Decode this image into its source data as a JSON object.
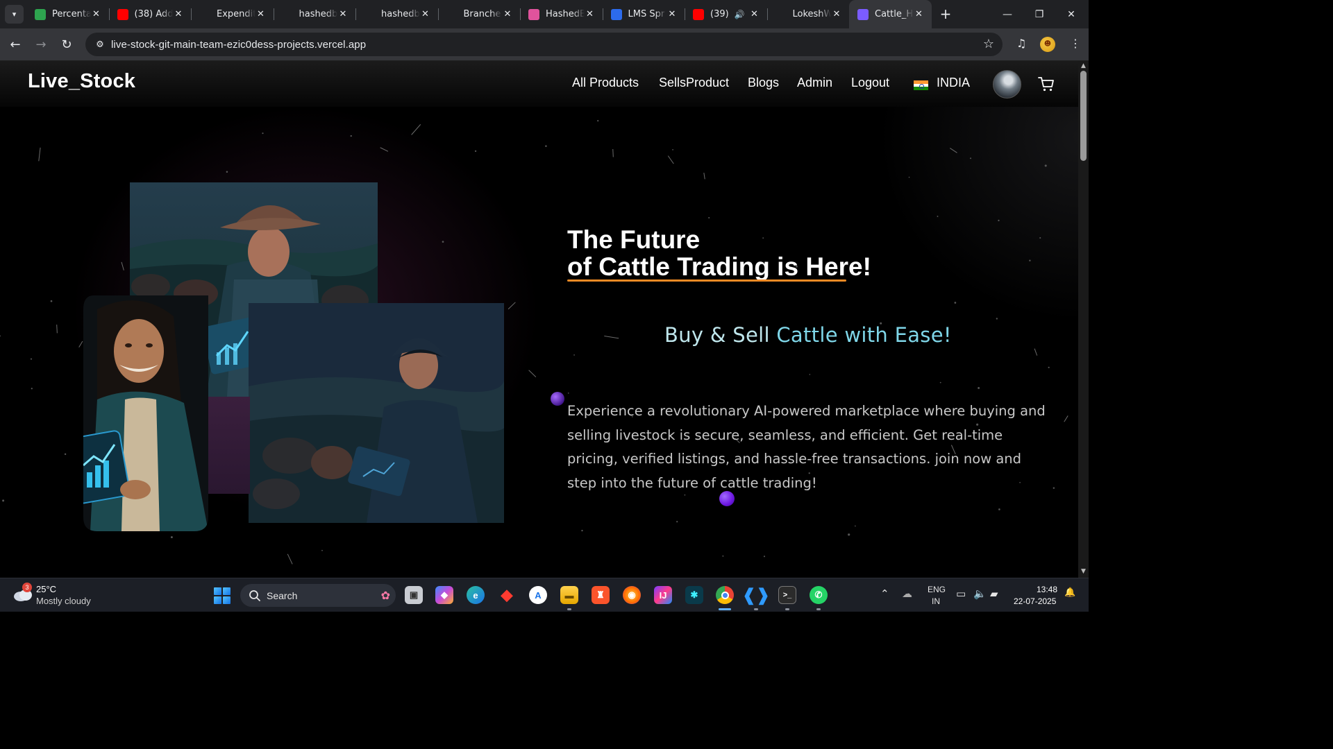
{
  "browser": {
    "tabs": [
      {
        "title": "Percenta",
        "icon": "percentage-app-icon",
        "color": "#2ea44f"
      },
      {
        "title": "(38) Add",
        "icon": "youtube-icon",
        "color": "#ff0000"
      },
      {
        "title": "Expendit",
        "icon": "chatgpt-icon",
        "color": "#202124"
      },
      {
        "title": "hashedb",
        "icon": "gmail-icon",
        "color": "#202124"
      },
      {
        "title": "hashedb",
        "icon": "github-icon",
        "color": "#202124"
      },
      {
        "title": "Branche",
        "icon": "github-icon",
        "color": "#202124"
      },
      {
        "title": "HashedB",
        "icon": "hashedbit-icon",
        "color": "#e0539c"
      },
      {
        "title": "LMS Spr",
        "icon": "lms-icon",
        "color": "#2c6bed"
      },
      {
        "title": "(39)",
        "icon": "youtube-icon",
        "color": "#ff0000"
      },
      {
        "title": "LokeshW",
        "icon": "github-icon",
        "color": "#202124"
      },
      {
        "title": "Cattle_H",
        "icon": "vite-icon",
        "color": "#7b5cff"
      }
    ],
    "active_tab_index": 10,
    "url": "live-stock-git-main-team-ezic0dess-projects.vercel.app"
  },
  "site": {
    "brand": "Live_Stock",
    "nav": {
      "all_products": "All Products",
      "sells_product": "SellsProduct",
      "blogs": "Blogs",
      "admin": "Admin",
      "logout": "Logout",
      "country": "INDIA"
    },
    "hero": {
      "title_line1": "The Future",
      "title_line2": "of Cattle Trading is Here!",
      "subtitle_part1": "Buy & Sell ",
      "subtitle_part2": "Cattle with Ease!",
      "description": "Experience a revolutionary AI-powered marketplace where buying and selling livestock is secure, seamless, and efficient. Get real-time pricing, verified listings, and hassle-free transactions. join now and step into the future of cattle trading!"
    },
    "colors": {
      "accent_underline": "#f08a24",
      "subtitle": "#bfe6ec",
      "orb_purple": "#7a22ff"
    }
  },
  "taskbar": {
    "weather_badge": "3",
    "temperature": "25°C",
    "weather": "Mostly cloudy",
    "search_label": "Search",
    "lang_line1": "ENG",
    "lang_line2": "IN",
    "time": "13:48",
    "date": "22-07-2025"
  }
}
